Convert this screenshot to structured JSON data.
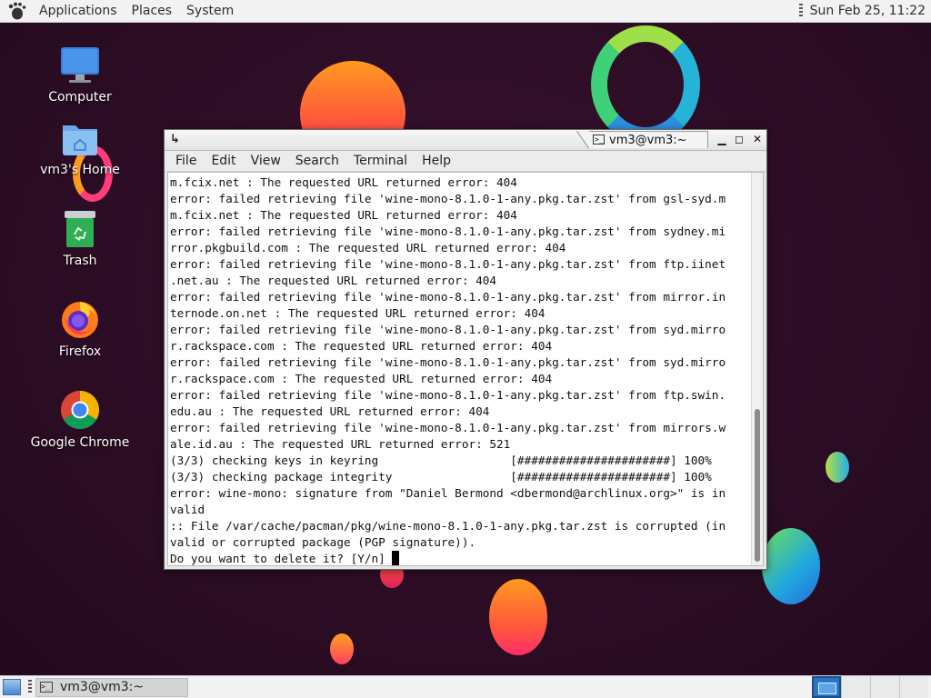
{
  "top_panel": {
    "menus": [
      "Applications",
      "Places",
      "System"
    ],
    "clock": "Sun Feb 25, 11:22",
    "icons": {
      "logo": "gnome-foot-icon"
    }
  },
  "desktop": {
    "icons": [
      {
        "label": "Computer",
        "icon": "monitor-icon"
      },
      {
        "label": "vm3's Home",
        "icon": "home-folder-icon"
      },
      {
        "label": "Trash",
        "icon": "trash-icon"
      },
      {
        "label": "Firefox",
        "icon": "firefox-icon"
      },
      {
        "label": "Google Chrome",
        "icon": "chrome-icon"
      }
    ]
  },
  "terminal": {
    "title": "vm3@vm3:~",
    "menu": [
      "File",
      "Edit",
      "View",
      "Search",
      "Terminal",
      "Help"
    ],
    "lines": [
      "m.fcix.net : The requested URL returned error: 404",
      "error: failed retrieving file 'wine-mono-8.1.0-1-any.pkg.tar.zst' from gsl-syd.m",
      "m.fcix.net : The requested URL returned error: 404",
      "error: failed retrieving file 'wine-mono-8.1.0-1-any.pkg.tar.zst' from sydney.mi",
      "rror.pkgbuild.com : The requested URL returned error: 404",
      "error: failed retrieving file 'wine-mono-8.1.0-1-any.pkg.tar.zst' from ftp.iinet",
      ".net.au : The requested URL returned error: 404",
      "error: failed retrieving file 'wine-mono-8.1.0-1-any.pkg.tar.zst' from mirror.in",
      "ternode.on.net : The requested URL returned error: 404",
      "error: failed retrieving file 'wine-mono-8.1.0-1-any.pkg.tar.zst' from syd.mirro",
      "r.rackspace.com : The requested URL returned error: 404",
      "error: failed retrieving file 'wine-mono-8.1.0-1-any.pkg.tar.zst' from syd.mirro",
      "r.rackspace.com : The requested URL returned error: 404",
      "error: failed retrieving file 'wine-mono-8.1.0-1-any.pkg.tar.zst' from ftp.swin.",
      "edu.au : The requested URL returned error: 404",
      "error: failed retrieving file 'wine-mono-8.1.0-1-any.pkg.tar.zst' from mirrors.w",
      "ale.id.au : The requested URL returned error: 521",
      "(3/3) checking keys in keyring                   [######################] 100%",
      "(3/3) checking package integrity                 [######################] 100%",
      "error: wine-mono: signature from \"Daniel Bermond <dbermond@archlinux.org>\" is in",
      "valid",
      ":: File /var/cache/pacman/pkg/wine-mono-8.1.0-1-any.pkg.tar.zst is corrupted (in",
      "valid or corrupted package (PGP signature)).",
      "Do you want to delete it? [Y/n] "
    ]
  },
  "bottom_panel": {
    "task_label": "vm3@vm3:~",
    "workspaces": 4,
    "active_workspace": 1
  }
}
